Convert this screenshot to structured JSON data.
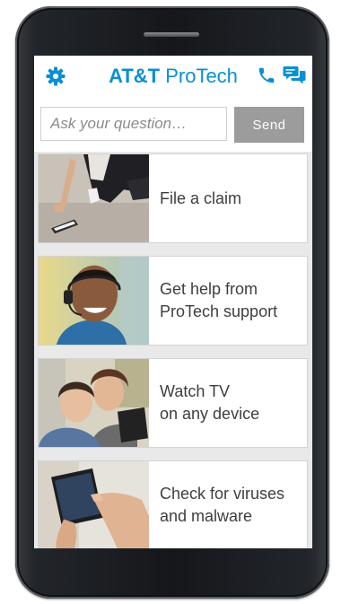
{
  "header": {
    "brand_bold": "AT&T",
    "brand_light": " ProTech",
    "icons": [
      "gear-icon",
      "phone-icon",
      "chat-icon"
    ],
    "accent_color": "#0a8fd3"
  },
  "search": {
    "placeholder": "Ask your question…",
    "value": "",
    "send_label": "Send",
    "send_color": "#9c9c9c"
  },
  "cards": [
    {
      "label": "File a claim"
    },
    {
      "label": "Get help from\nProTech support"
    },
    {
      "label": "Watch TV\non any device"
    },
    {
      "label": "Check for viruses\nand malware"
    }
  ]
}
